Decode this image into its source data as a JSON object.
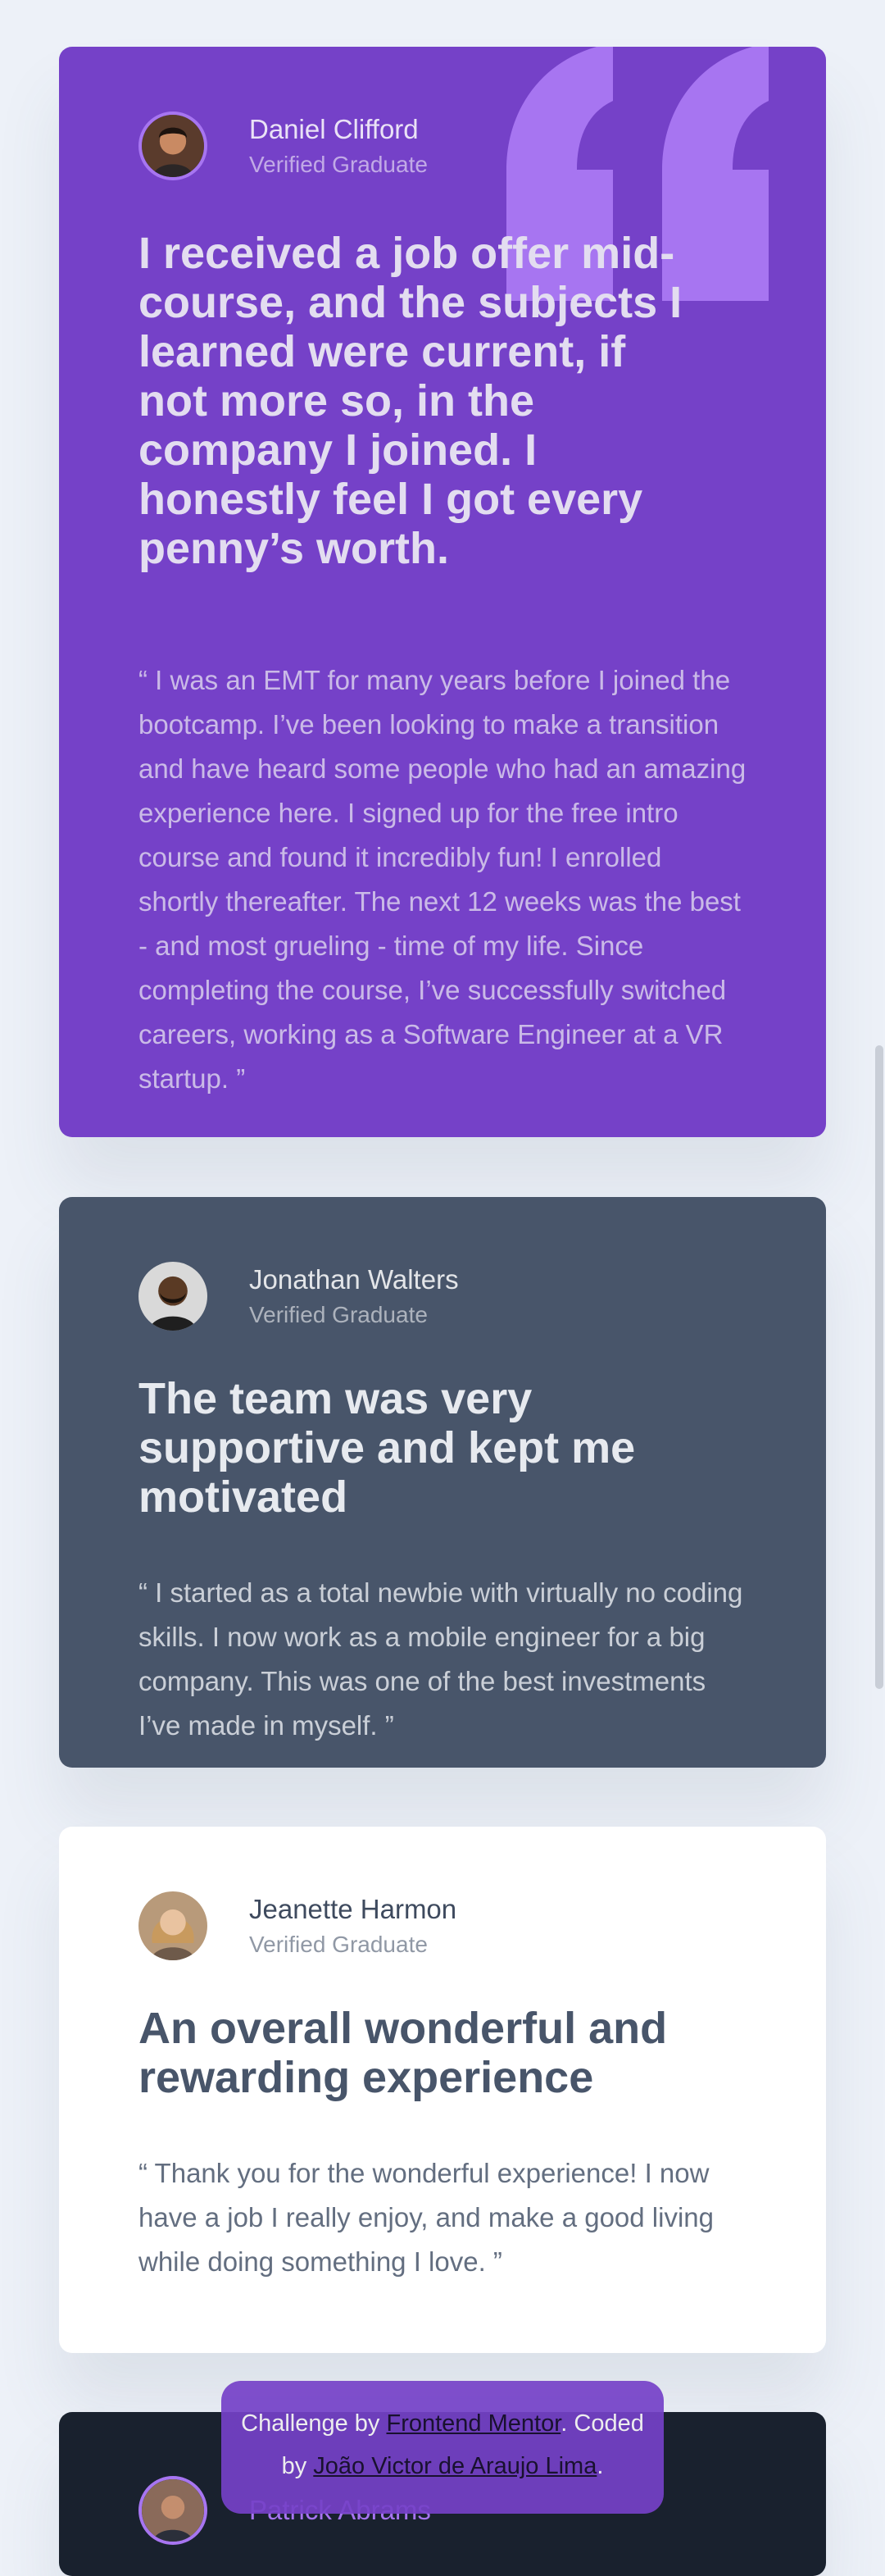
{
  "testimonials": [
    {
      "name": "Daniel Clifford",
      "role": "Verified Graduate",
      "headline": "I received a job offer mid-course, and the subjects I learned were current, if not more so, in the company I joined. I honestly feel I got every penny’s worth.",
      "body": "“ I was an EMT for many years before I joined the bootcamp. I’ve been looking to make a transition and have heard some people who had an amazing experience here. I signed up for the free intro course and found it incredibly fun! I enrolled shortly thereafter. The next 12 weeks was the best - and most grueling - time of my life. Since completing the course, I’ve successfully switched careers, working as a Software Engineer at a VR startup. ”",
      "background": "#7541c8"
    },
    {
      "name": "Jonathan Walters",
      "role": "Verified Graduate",
      "headline": "The team was very supportive and kept me motivated",
      "body": "“ I started as a total newbie with virtually no coding skills. I now work as a mobile engineer for a big company. This was one of the best investments I’ve made in myself. ”",
      "background": "#48556a"
    },
    {
      "name": "Jeanette Harmon",
      "role": "Verified Graduate",
      "headline": "An overall wonderful and rewarding experience",
      "body": "“ Thank you for the wonderful experience! I now have a job I really enjoy, and make a good living while doing something I love. ”",
      "background": "#ffffff"
    },
    {
      "name": "Patrick Abrams",
      "background": "#19212e"
    }
  ],
  "attribution": {
    "prefix": "Challenge by ",
    "challenge_link": "Frontend Mentor",
    "middle": ". Coded by ",
    "author_link": "João Victor de Araujo Lima",
    "suffix": "."
  },
  "colors": {
    "page_background": "#edf1f8",
    "accent_purple": "#7541c8",
    "quote_mark": "#a775f1"
  },
  "icons": {
    "decorative_quote": "quote-mark-icon"
  }
}
